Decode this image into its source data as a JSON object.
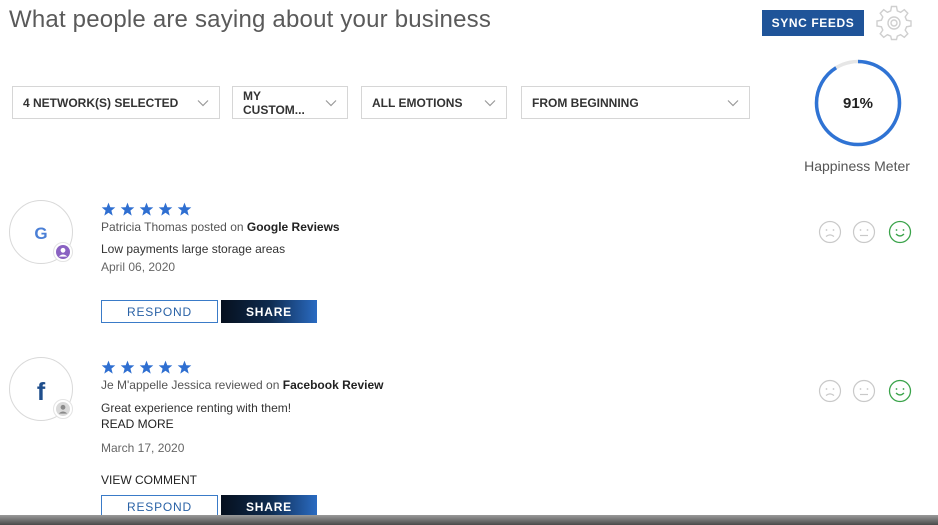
{
  "header": {
    "title": "What people are saying about your business",
    "sync_label": "SYNC FEEDS"
  },
  "filters": {
    "networks": "4 NETWORK(S) SELECTED",
    "customers": "MY CUSTOM...",
    "emotions": "ALL EMOTIONS",
    "period": "FROM BEGINNING"
  },
  "happiness": {
    "percent": 91,
    "value_text": "91%",
    "label": "Happiness Meter",
    "ring_color": "#2f73d4"
  },
  "icons": {
    "settings": "gear-icon",
    "dropdown": "chevron-down-icon",
    "star": "star-icon",
    "sad": "sad-face-icon",
    "neutral": "neutral-face-icon",
    "happy": "happy-face-icon",
    "google": "google-g-icon",
    "facebook": "facebook-f-icon",
    "user": "user-avatar-icon"
  },
  "colors": {
    "star": "#2f6fd1",
    "happy_selected": "#3aa34a",
    "face_inactive": "#c9c9c9",
    "sync_button": "#1f5499"
  },
  "reviews": [
    {
      "network_icon": "google-g-icon",
      "rating": 5,
      "author": "Patricia Thomas",
      "verb": "posted on",
      "network": "Google Reviews",
      "text": "Low payments large storage areas",
      "date": "April 06, 2020",
      "respond_label": "RESPOND",
      "share_label": "SHARE",
      "selected_emotion": "happy"
    },
    {
      "network_icon": "facebook-f-icon",
      "rating": 5,
      "author": "Je M'appelle Jessica",
      "verb": "reviewed on",
      "network": "Facebook Review",
      "text": "Great experience renting with them!",
      "read_more": "READ MORE",
      "date": "March 17, 2020",
      "view_comment": "VIEW COMMENT",
      "respond_label": "RESPOND",
      "share_label": "SHARE",
      "selected_emotion": "happy"
    }
  ]
}
